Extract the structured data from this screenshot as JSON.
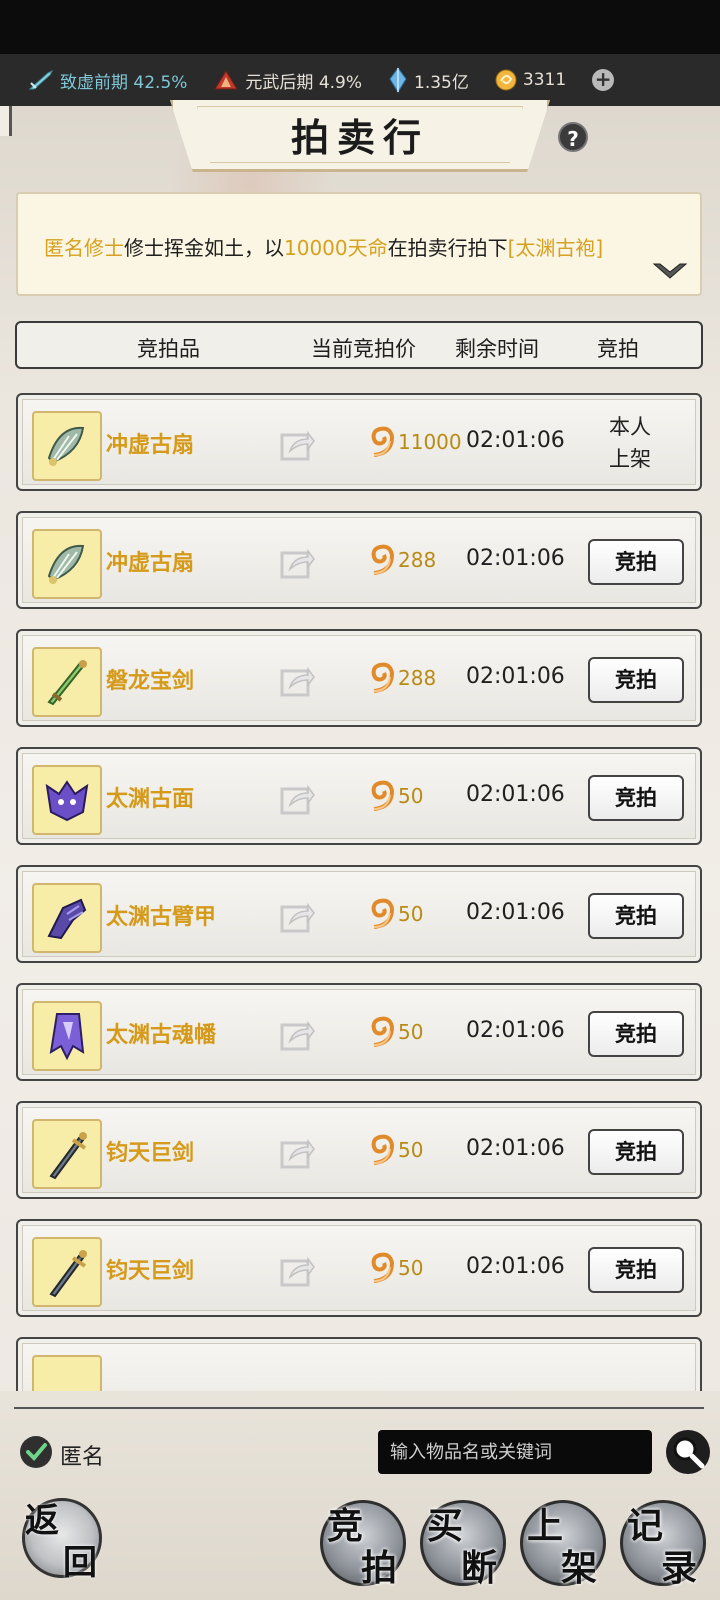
{
  "resources": [
    {
      "label": "致虚前期 42.5%",
      "icon": "sword-cultivation-icon",
      "color": "#7fc7d6"
    },
    {
      "label": "元武后期 4.9%",
      "icon": "martial-tree-icon",
      "color": "#e6e0d6"
    },
    {
      "label": "1.35亿",
      "icon": "spirit-crystal-icon",
      "color": "#e6e0d6"
    },
    {
      "label": "3311",
      "icon": "heaven-destiny-coin-icon",
      "color": "#e6e0d6"
    }
  ],
  "title": "拍卖行",
  "help_label": "?",
  "notice": {
    "user": "匿名修士",
    "text1": "修士挥金如土，以",
    "amount": "10000天命",
    "text2": "在拍卖行拍下",
    "item": "[太渊古袍]"
  },
  "columns": {
    "item": "竞拍品",
    "price": "当前竞拍价",
    "time": "剩余时间",
    "action": "竞拍"
  },
  "rows": [
    {
      "name": "冲虚古扇",
      "price": "11000",
      "time": "02:01:06",
      "self": "本人上架",
      "icon": "fan-icon"
    },
    {
      "name": "冲虚古扇",
      "price": "288",
      "time": "02:01:06",
      "button": "竞拍",
      "icon": "fan-icon"
    },
    {
      "name": "磐龙宝剑",
      "price": "288",
      "time": "02:01:06",
      "button": "竞拍",
      "icon": "jade-sword-icon"
    },
    {
      "name": "太渊古面",
      "price": "50",
      "time": "02:01:06",
      "button": "竞拍",
      "icon": "demon-mask-icon"
    },
    {
      "name": "太渊古臂甲",
      "price": "50",
      "time": "02:01:06",
      "button": "竞拍",
      "icon": "gauntlet-icon"
    },
    {
      "name": "太渊古魂幡",
      "price": "50",
      "time": "02:01:06",
      "button": "竞拍",
      "icon": "soul-banner-icon"
    },
    {
      "name": "钧天巨剑",
      "price": "50",
      "time": "02:01:06",
      "button": "竞拍",
      "icon": "greatsword-icon"
    },
    {
      "name": "钧天巨剑",
      "price": "50",
      "time": "02:01:06",
      "button": "竞拍",
      "icon": "greatsword-icon"
    }
  ],
  "anonymous_label": "匿名",
  "search_placeholder": "输入物品名或关键词",
  "nav": {
    "back": [
      "返",
      "回"
    ],
    "bid": [
      "竞",
      "拍"
    ],
    "buyout": [
      "买",
      "断"
    ],
    "list": [
      "上",
      "架"
    ],
    "record": [
      "记",
      "录"
    ]
  }
}
